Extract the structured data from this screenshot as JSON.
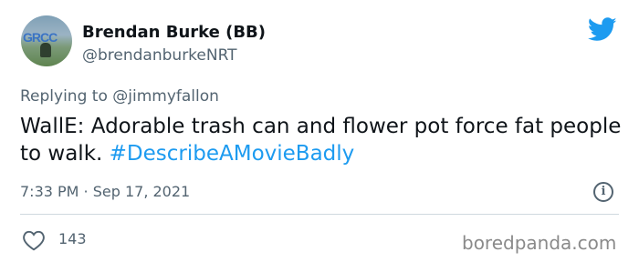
{
  "author": {
    "name": "Brendan Burke (BB)",
    "handle": "@brendanburkeNRT",
    "avatar_sign_text": "GRCC"
  },
  "reply": {
    "prefix": "Replying to ",
    "mention": "@jimmyfallon"
  },
  "tweet": {
    "text": "WallE: Adorable trash can and flower pot force fat people to walk. ",
    "hashtag": "#DescribeAMovieBadly",
    "timestamp": "7:33 PM · Sep 17, 2021"
  },
  "icons": {
    "brand": "twitter-bird-icon",
    "info": "info-icon",
    "like": "heart-icon"
  },
  "engagement": {
    "likes": "143"
  },
  "colors": {
    "brand_blue": "#1d9bf0",
    "secondary_text": "#536471",
    "primary_text": "#0f1419"
  },
  "watermark": "boredpanda.com"
}
